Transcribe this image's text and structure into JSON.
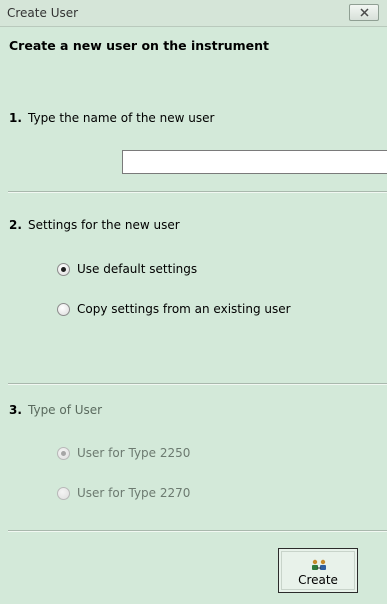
{
  "window": {
    "title": "Create User"
  },
  "heading": "Create a new user on the instrument",
  "step1": {
    "number": "1.",
    "label": "Type the name of the new user",
    "input_value": ""
  },
  "step2": {
    "number": "2.",
    "label": "Settings for the new user",
    "options": [
      {
        "label": "Use default settings",
        "checked": true
      },
      {
        "label": "Copy settings from an existing user",
        "checked": false
      }
    ]
  },
  "step3": {
    "number": "3.",
    "label": "Type of User",
    "enabled": false,
    "options": [
      {
        "label": "User for Type 2250",
        "checked": true
      },
      {
        "label": "User for Type 2270",
        "checked": false
      }
    ]
  },
  "create_button": {
    "label": "Create",
    "icon": "users-icon"
  },
  "colors": {
    "background": "#d3e9d9",
    "divider": "#a9b8ad",
    "disabled_text": "#5a6a5e"
  }
}
